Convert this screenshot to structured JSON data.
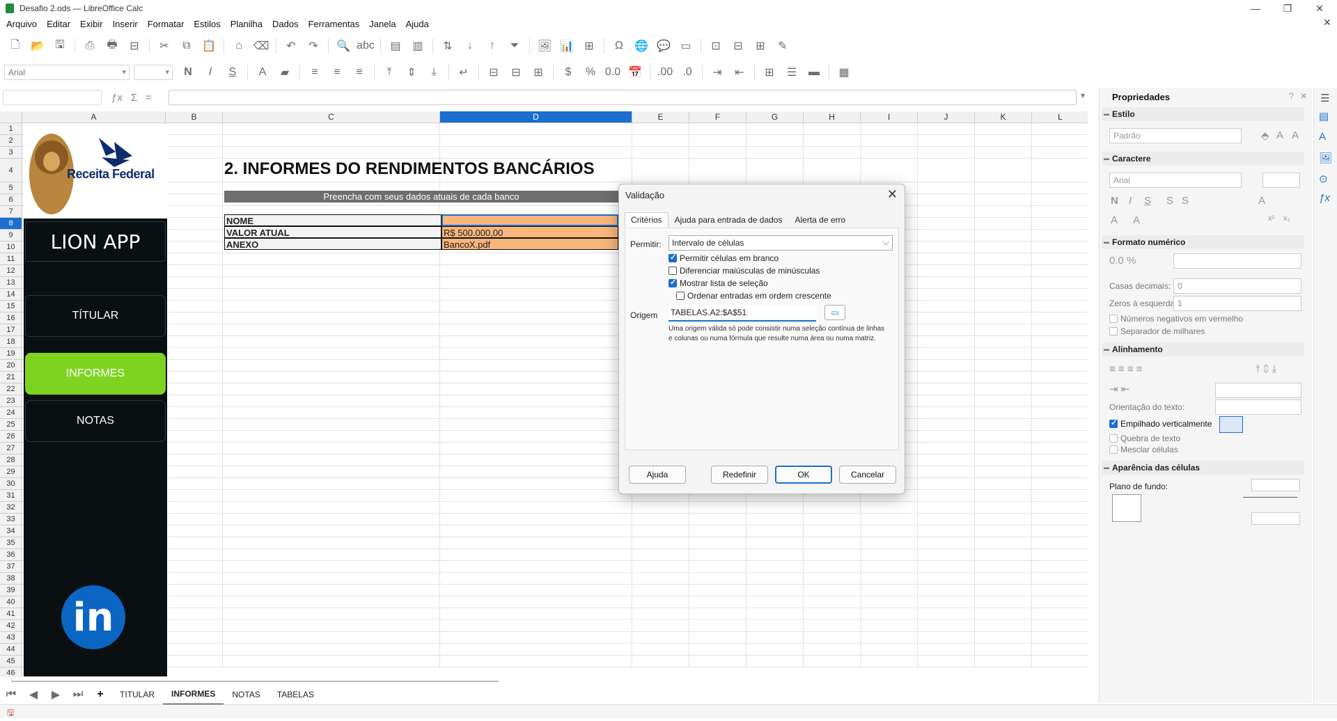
{
  "window": {
    "title": "Desafio 2.ods — LibreOffice Calc"
  },
  "menu": [
    "Arquivo",
    "Editar",
    "Exibir",
    "Inserir",
    "Formatar",
    "Estilos",
    "Planilha",
    "Dados",
    "Ferramentas",
    "Janela",
    "Ajuda"
  ],
  "toolbar": {
    "font_name": "Arial"
  },
  "columns": [
    "A",
    "B",
    "C",
    "D",
    "E",
    "F",
    "G",
    "H",
    "I",
    "J",
    "K",
    "L"
  ],
  "rows": [
    "1",
    "2",
    "3",
    "4",
    "5",
    "6",
    "7",
    "8",
    "9",
    "10",
    "11",
    "12",
    "13",
    "14",
    "15",
    "16",
    "17",
    "18",
    "19",
    "20",
    "21",
    "22",
    "23",
    "24",
    "25",
    "26",
    "27",
    "28",
    "29",
    "30",
    "31",
    "32",
    "33",
    "34",
    "35",
    "36",
    "37",
    "38",
    "39",
    "40",
    "41",
    "42",
    "43",
    "44",
    "45",
    "46"
  ],
  "sheet": {
    "logo_text": "Receita Federal",
    "app_name": "LION APP",
    "nav": {
      "titular": "TÍTULAR",
      "informes": "INFORMES",
      "notas": "NOTAS"
    },
    "linkedin": "in",
    "heading": "2. INFORMES DO RENDIMENTOS BANCÁRIOS",
    "subheader": "Preencha com seus dados atuais de cada banco",
    "form": [
      {
        "label": "NOME",
        "value": ""
      },
      {
        "label": "VALOR ATUAL",
        "value": "R$ 500.000,00"
      },
      {
        "label": "ANEXO",
        "value": "BancoX.pdf"
      }
    ]
  },
  "dialog": {
    "title": "Validação",
    "tabs": [
      "Critérios",
      "Ajuda para entrada de dados",
      "Alerta de erro"
    ],
    "permitir_label": "Permitir:",
    "permitir_value": "Intervalo de células",
    "options": [
      {
        "label": "Permitir células em branco",
        "checked": true
      },
      {
        "label": "Diferenciar maiúsculas de minúsculas",
        "checked": false
      },
      {
        "label": "Mostrar lista de seleção",
        "checked": true
      },
      {
        "label": "Ordenar entradas em ordem crescente",
        "checked": false
      }
    ],
    "origem_label": "Origem",
    "origem_value": "TABELAS.A2:$A$51",
    "help_text": "Uma origem válida só pode consistir numa seleção contínua de linhas e colunas ou numa fórmula que resulte numa área ou numa matriz.",
    "buttons": {
      "help": "Ajuda",
      "reset": "Redefinir",
      "ok": "OK",
      "cancel": "Cancelar"
    }
  },
  "properties": {
    "title": "Propriedades",
    "estilo": {
      "header": "Estilo",
      "value": "Padrão"
    },
    "caractere": {
      "header": "Caractere",
      "font": "Arial"
    },
    "formato": {
      "header": "Formato numérico",
      "casas_label": "Casas decimais:",
      "casas_value": "0",
      "zeros_label": "Zeros à esquerda:",
      "zeros_value": "1",
      "neg_label": "Números negativos em vermelho",
      "sep_label": "Separador de milhares"
    },
    "alinhamento": {
      "header": "Alinhamento",
      "orient_label": "Orientação do texto:",
      "empilhado": "Empilhado verticalmente",
      "quebra": "Quebra de texto",
      "mesclar": "Mesclar células"
    },
    "aparencia": {
      "header": "Aparência das células",
      "plano": "Plano de fundo:"
    }
  },
  "sheet_tabs": [
    "TITULAR",
    "INFORMES",
    "NOTAS",
    "TABELAS"
  ],
  "active_sheet": "INFORMES"
}
